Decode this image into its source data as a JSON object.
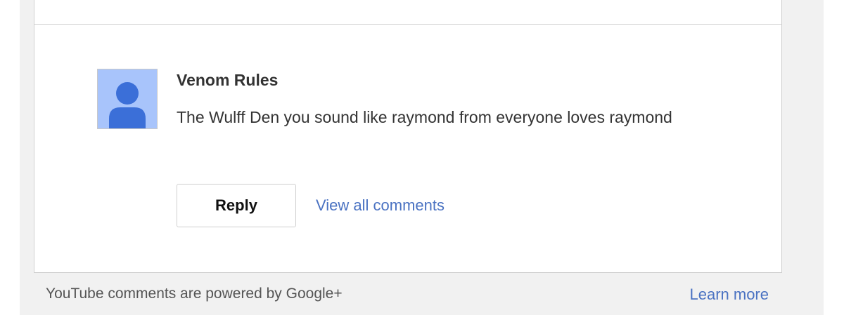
{
  "comment": {
    "author": "Venom Rules",
    "text": "The Wulff Den you sound like raymond from everyone loves raymond",
    "avatar_icon": "default-user-icon",
    "avatar_bg": "#a8c4fb",
    "avatar_fg": "#3b6fd8"
  },
  "actions": {
    "reply_label": "Reply",
    "view_all_label": "View all comments"
  },
  "footer": {
    "powered_text": "YouTube comments are powered by Google+",
    "learn_more_label": "Learn more"
  },
  "colors": {
    "link": "#4a72c2",
    "panel_bg": "#f1f1f1"
  }
}
